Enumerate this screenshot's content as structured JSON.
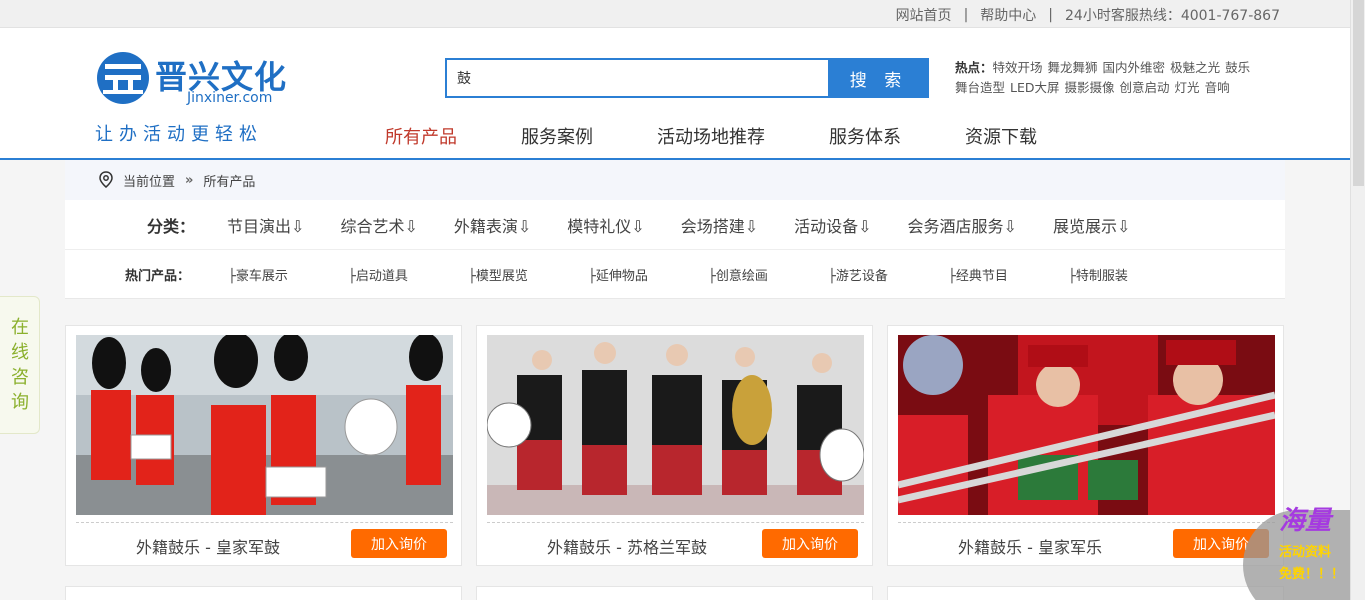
{
  "topbar": {
    "home": "网站首页",
    "help": "帮助中心",
    "hotline": "24小时客服热线：4001-767-867"
  },
  "logo": {
    "brand": "晋兴文化",
    "domain": "Jinxiner.com",
    "slogan": "让办活动更轻松",
    "color": "#1f6fc4"
  },
  "search": {
    "value": "鼓",
    "button": "搜 索"
  },
  "hotwords": {
    "label": "热点：",
    "items": [
      "特效开场",
      "舞龙舞狮",
      "国内外维密",
      "极魅之光",
      "鼓乐",
      "舞台造型",
      "LED大屏",
      "摄影摄像",
      "创意启动",
      "灯光",
      "音响"
    ]
  },
  "nav": {
    "items": [
      "所有产品",
      "服务案例",
      "活动场地推荐",
      "服务体系",
      "资源下载"
    ],
    "active_color": "#c0392b"
  },
  "breadcrumb": {
    "current_label": "当前位置",
    "arrow": "»",
    "page": "所有产品"
  },
  "filters": {
    "category_label": "分类：",
    "categories": [
      "节目演出⇩",
      "综合艺术⇩",
      "外籍表演⇩",
      "模特礼仪⇩",
      "会场搭建⇩",
      "活动设备⇩",
      "会务酒店服务⇩",
      "展览展示⇩"
    ],
    "hot_label": "热门产品：",
    "hot_items": [
      "├豪车展示",
      "├启动道具",
      "├模型展览",
      "├延伸物品",
      "├创意绘画",
      "├游艺设备",
      "├经典节目",
      "├特制服装"
    ]
  },
  "products": [
    {
      "title": "外籍鼓乐 - 皇家军鼓",
      "button": "加入询价"
    },
    {
      "title": "外籍鼓乐 - 苏格兰军鼓",
      "button": "加入询价"
    },
    {
      "title": "外籍鼓乐 - 皇家军乐",
      "button": "加入询价"
    }
  ],
  "consult": {
    "label": "在线咨询"
  },
  "promo": {
    "big": "海量",
    "line1": "活动资料",
    "line2": "免费！！！"
  },
  "colors": {
    "accent": "#2b7fd4",
    "button_orange": "#ff6a00",
    "hotline_red": "#c00000"
  }
}
